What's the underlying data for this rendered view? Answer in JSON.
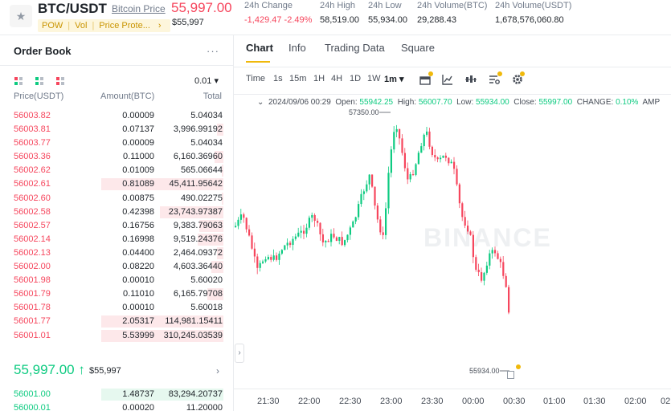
{
  "header": {
    "pair": "BTC/USDT",
    "pair_link": "Bitcoin Price",
    "tags": [
      "POW",
      "Vol",
      "Price Prote..."
    ],
    "tag_arrow": "›",
    "last_price": "55,997.00",
    "last_price_usd": "$55,997",
    "stats": [
      {
        "label": "24h Change",
        "value": "-1,429.47 -2.49%",
        "color": "#f6465d"
      },
      {
        "label": "24h High",
        "value": "58,519.00"
      },
      {
        "label": "24h Low",
        "value": "55,934.00"
      },
      {
        "label": "24h Volume(BTC)",
        "value": "29,288.43"
      },
      {
        "label": "24h Volume(USDT)",
        "value": "1,678,576,060.80"
      }
    ]
  },
  "order_book": {
    "title": "Order Book",
    "more": "···",
    "step": "0.01 ▾",
    "columns": {
      "price": "Price(USDT)",
      "amount": "Amount(BTC)",
      "total": "Total"
    },
    "asks": [
      {
        "price": "56003.82",
        "amount": "0.00009",
        "total": "5.04034",
        "depth": 0
      },
      {
        "price": "56003.81",
        "amount": "0.07137",
        "total": "3,996.99192",
        "depth": 0.05
      },
      {
        "price": "56003.77",
        "amount": "0.00009",
        "total": "5.04034",
        "depth": 0
      },
      {
        "price": "56003.36",
        "amount": "0.11000",
        "total": "6,160.36960",
        "depth": 0.07
      },
      {
        "price": "56002.62",
        "amount": "0.01009",
        "total": "565.06644",
        "depth": 0.01
      },
      {
        "price": "56002.61",
        "amount": "0.81089",
        "total": "45,411.95642",
        "depth": 1.0
      },
      {
        "price": "56002.60",
        "amount": "0.00875",
        "total": "490.02275",
        "depth": 0.01
      },
      {
        "price": "56002.58",
        "amount": "0.42398",
        "total": "23,743.97387",
        "depth": 0.52
      },
      {
        "price": "56002.57",
        "amount": "0.16756",
        "total": "9,383.79063",
        "depth": 0.2
      },
      {
        "price": "56002.14",
        "amount": "0.16998",
        "total": "9,519.24376",
        "depth": 0.21
      },
      {
        "price": "56002.13",
        "amount": "0.04400",
        "total": "2,464.09372",
        "depth": 0.05
      },
      {
        "price": "56002.00",
        "amount": "0.08220",
        "total": "4,603.36440",
        "depth": 0.1
      },
      {
        "price": "56001.98",
        "amount": "0.00010",
        "total": "5.60020",
        "depth": 0
      },
      {
        "price": "56001.79",
        "amount": "0.11010",
        "total": "6,165.79708",
        "depth": 0.13
      },
      {
        "price": "56001.78",
        "amount": "0.00010",
        "total": "5.60018",
        "depth": 0
      },
      {
        "price": "56001.77",
        "amount": "2.05317",
        "total": "114,981.15411",
        "depth": 1.0
      },
      {
        "price": "56001.01",
        "amount": "5.53999",
        "total": "310,245.03539",
        "depth": 1.0
      }
    ],
    "mid_price": "55,997.00",
    "mid_arrow": "↑",
    "mid_usd": "$55,997",
    "mid_chevron": "›",
    "bids": [
      {
        "price": "56001.00",
        "amount": "1.48737",
        "total": "83,294.20737",
        "depth": 1.0
      },
      {
        "price": "56000.01",
        "amount": "0.00020",
        "total": "11.20000",
        "depth": 0
      }
    ]
  },
  "chart": {
    "tabs": [
      "Chart",
      "Info",
      "Trading Data",
      "Square"
    ],
    "active_tab": "Chart",
    "timeframes": [
      "Time",
      "1s",
      "15m",
      "1H",
      "4H",
      "1D",
      "1W",
      "1m ▾"
    ],
    "active_timeframe": "1m ▾",
    "ohlc": {
      "date": "2024/09/06 00:29",
      "open_label": "Open:",
      "open": "55942.25",
      "high_label": "High:",
      "high": "56007.70",
      "low_label": "Low:",
      "low": "55934.00",
      "close_label": "Close:",
      "close": "55997.00",
      "change_label": "CHANGE:",
      "change": "0.10%",
      "amp_label": "AMP"
    },
    "high_marker": "57350.00",
    "low_marker": "55934.00",
    "watermark": "BINANCE",
    "x_labels": [
      "21:30",
      "22:00",
      "22:30",
      "23:00",
      "23:30",
      "00:00",
      "00:30",
      "01:00",
      "01:30",
      "02:00",
      "02"
    ],
    "collapse": "›",
    "up_color": "#0ecb81",
    "down_color": "#f6465d",
    "accent": "#f0b90b"
  }
}
